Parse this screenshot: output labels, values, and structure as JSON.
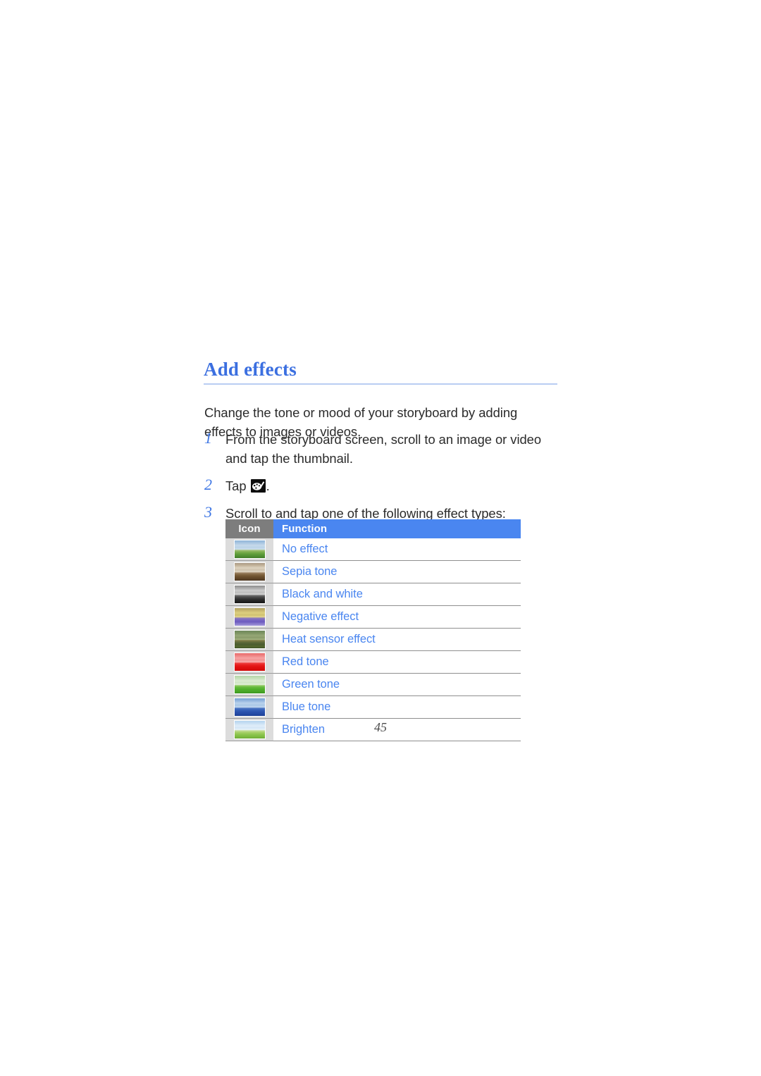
{
  "document": {
    "heading": "Add effects",
    "intro": "Change the tone or mood of your storyboard by adding effects to images or videos.",
    "page_number": "45",
    "accent_color": "#4a86f0",
    "heading_color": "#3b6fe0",
    "header_icon_bg": "#7d7d7d",
    "icon_cell_bg": "#dcdcdc"
  },
  "steps": [
    {
      "number": "1",
      "text": "From the storyboard screen, scroll to an image or video and tap the thumbnail."
    },
    {
      "number": "2",
      "text_before": "Tap ",
      "icon": "palette-icon",
      "text_after": "."
    },
    {
      "number": "3",
      "text": "Scroll to and tap one of the following effect types:"
    }
  ],
  "table": {
    "headers": {
      "icon": "Icon",
      "function": "Function"
    },
    "rows": [
      {
        "thumb": "thumb-normal",
        "function": "No effect"
      },
      {
        "thumb": "thumb-sepia",
        "function": "Sepia tone"
      },
      {
        "thumb": "thumb-bw",
        "function": "Black and white"
      },
      {
        "thumb": "thumb-negative",
        "function": "Negative effect"
      },
      {
        "thumb": "thumb-heat",
        "function": "Heat sensor effect"
      },
      {
        "thumb": "thumb-red",
        "function": "Red tone"
      },
      {
        "thumb": "thumb-green",
        "function": "Green tone"
      },
      {
        "thumb": "thumb-blue",
        "function": "Blue tone"
      },
      {
        "thumb": "thumb-brighten",
        "function": "Brighten"
      }
    ]
  }
}
